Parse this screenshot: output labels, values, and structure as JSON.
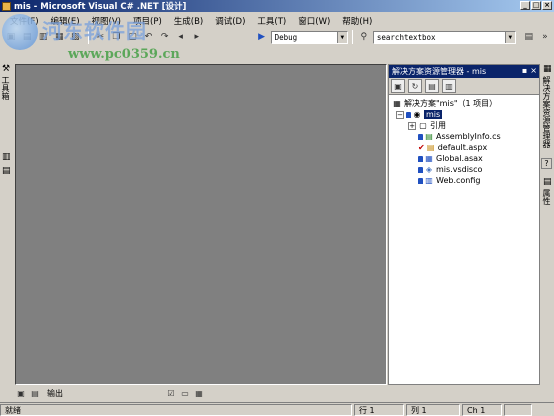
{
  "window": {
    "title": "mis - Microsoft Visual C# .NET [设计]",
    "minimize": "_",
    "maximize": "□",
    "close": "×"
  },
  "menu": [
    "文件(F)",
    "编辑(E)",
    "视图(V)",
    "项目(P)",
    "生成(B)",
    "调试(D)",
    "工具(T)",
    "窗口(W)",
    "帮助(H)"
  ],
  "toolbar": {
    "config_value": "Debug",
    "search_value": "searchtextbox",
    "overflow": "»"
  },
  "watermark": {
    "brand": "河东软件园",
    "url": "www.pc0359.cn"
  },
  "left_strip": {
    "toolbox_label": "工具箱"
  },
  "solution_explorer": {
    "title": "解决方案资源管理器 - mis",
    "pin": "▪",
    "close": "×",
    "solution_label": "解决方案\"mis\"（1 项目）",
    "project": "mis",
    "items": [
      {
        "label": "引用",
        "icon": "references-icon"
      },
      {
        "label": "AssemblyInfo.cs",
        "icon": "cs-file-icon"
      },
      {
        "label": "default.aspx",
        "icon": "aspx-file-icon"
      },
      {
        "label": "Global.asax",
        "icon": "asax-file-icon"
      },
      {
        "label": "mis.vsdisco",
        "icon": "vsdisco-file-icon"
      },
      {
        "label": "Web.config",
        "icon": "config-file-icon"
      }
    ]
  },
  "right_strip": {
    "solution_tab": "解决方案资源管理器",
    "help_symbol": "?",
    "properties_tab": "属性"
  },
  "bottom": {
    "output_label": "输出"
  },
  "status": {
    "ready": "就绪",
    "row": "行 1",
    "col": "列 1",
    "ch": "Ch 1"
  }
}
